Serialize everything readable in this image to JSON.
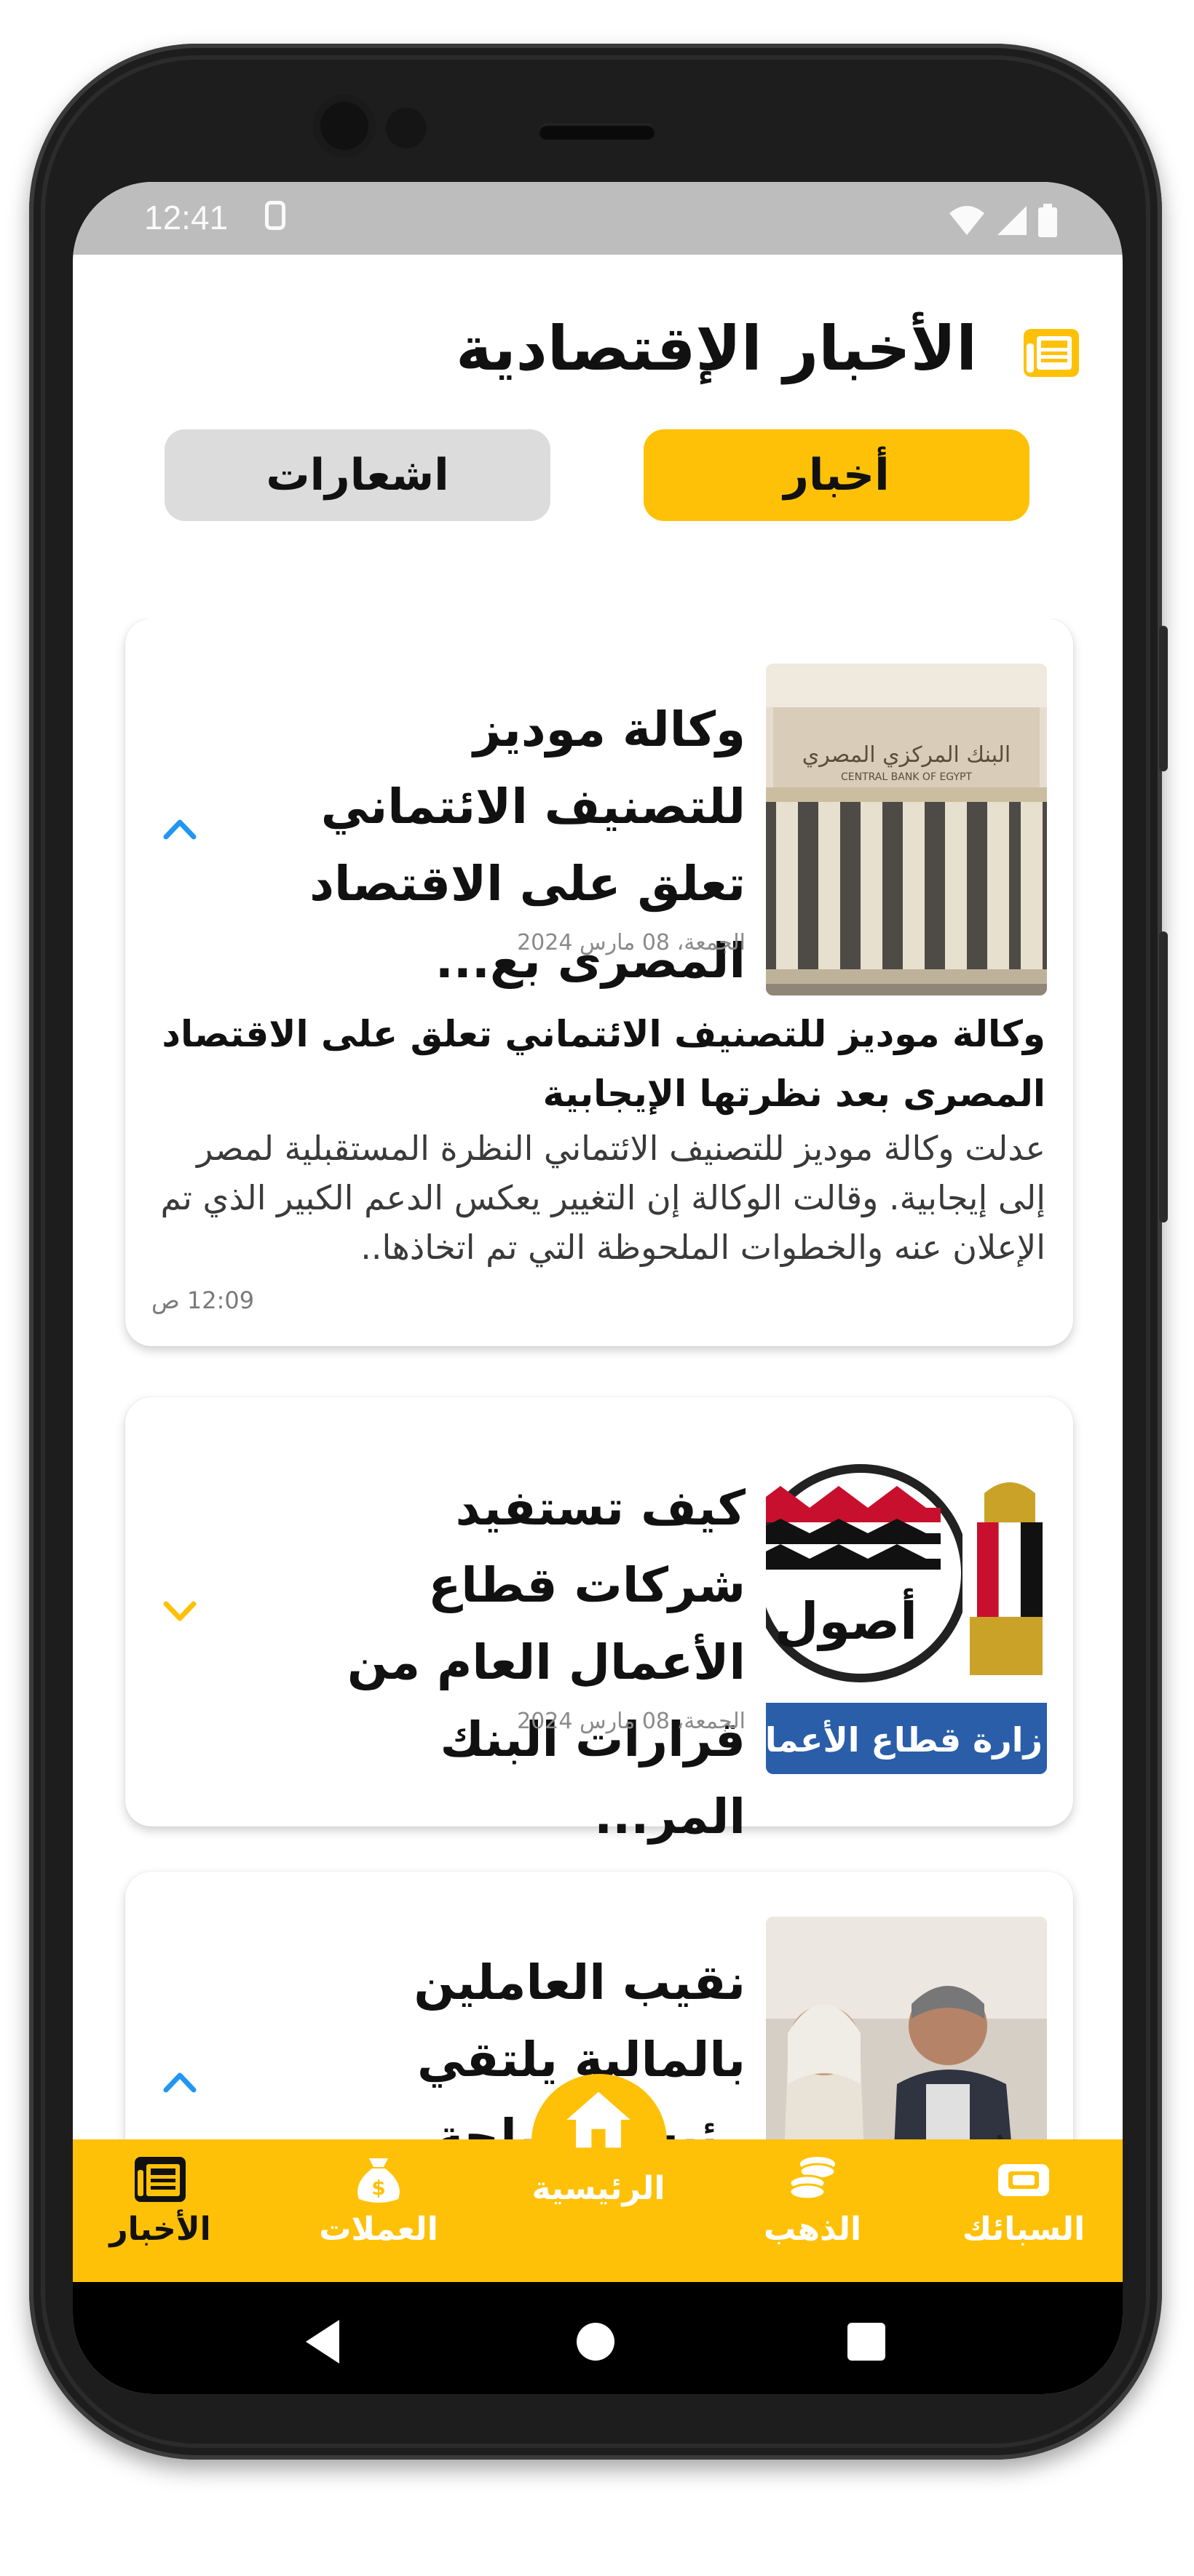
{
  "status_bar": {
    "time": "12:41",
    "icons": [
      "sim-icon",
      "wifi-icon",
      "signal-icon",
      "battery-icon"
    ]
  },
  "header": {
    "title": "الأخبار الإقتصادية",
    "icon": "newspaper-icon"
  },
  "tabs": [
    {
      "label": "أخبار",
      "active": true
    },
    {
      "label": "اشعارات",
      "active": false
    }
  ],
  "articles": [
    {
      "title": "وكالة موديز للتصنيف الائتماني تعلق على الاقتصاد المصرى بع...",
      "date": "الجمعة، 08 مارس 2024",
      "expanded": true,
      "image": "central-bank-of-egypt-building",
      "body_title": "وكالة موديز للتصنيف الائتماني تعلق على الاقتصاد المصرى بعد نظرتها الإيجابية",
      "body_text": "عدلت وكالة موديز للتصنيف الائتماني النظرة المستقبلية لمصر إلى إيجابية. وقالت الوكالة إن التغيير يعكس الدعم الكبير الذي تم الإعلان عنه والخطوات الملحوظة التي تم اتخاذها..",
      "time": "12:09 ص"
    },
    {
      "title": "كيف تستفيد شركات قطاع الأعمال العام من قرارات البنك المر...",
      "date": "الجمعة، 08 مارس 2024",
      "expanded": false,
      "image": "public-business-sector-ministry-logo",
      "image_caption": "زارة قطاع الأعمال ال"
    },
    {
      "title": "نقيب العاملين بالمالية يلتقي رئيس مصلحة",
      "expanded": true,
      "image": "meeting-photo"
    }
  ],
  "bottom_nav": [
    {
      "label": "الأخبار",
      "icon": "newspaper-icon"
    },
    {
      "label": "العملات",
      "icon": "money-bag-icon"
    },
    {
      "label": "الرئيسية",
      "icon": "home-icon"
    },
    {
      "label": "الذهب",
      "icon": "coins-icon"
    },
    {
      "label": "السبائك",
      "icon": "gold-bar-icon"
    }
  ],
  "colors": {
    "accent": "#FFC107",
    "chevron_up": "#2196F3",
    "chevron_down": "#FFC107"
  }
}
